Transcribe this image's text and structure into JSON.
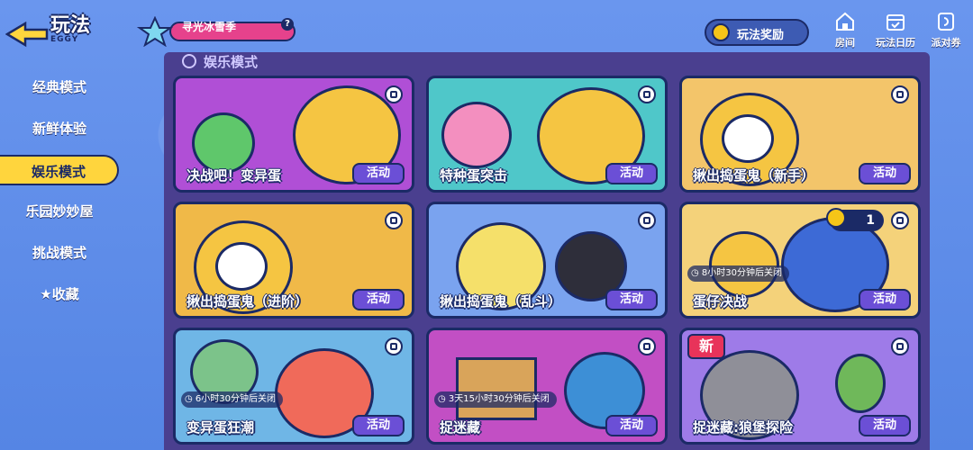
{
  "header": {
    "title": "玩法",
    "subtitle": "EGGY",
    "season_label": "寻光冰雪季",
    "help_icon": "question-icon",
    "reward_label": "玩法奖励",
    "top_icons": [
      {
        "label": "房间",
        "icon": "home-icon"
      },
      {
        "label": "玩法日历",
        "icon": "calendar-icon"
      },
      {
        "label": "派对券",
        "icon": "ticket-icon"
      }
    ]
  },
  "sidebar": {
    "items": [
      {
        "label": "经典模式"
      },
      {
        "label": "新鲜体验"
      },
      {
        "label": "娱乐模式"
      },
      {
        "label": "乐园妙妙屋"
      },
      {
        "label": "挑战模式"
      },
      {
        "label": "★收藏"
      }
    ],
    "active_index": 2
  },
  "panel": {
    "section_title": "娱乐模式",
    "action_label": "活动",
    "cards": [
      {
        "name": "决战吧！变异蛋",
        "theme": "#b04fd6"
      },
      {
        "name": "特种蛋突击",
        "theme": "#4fc7c9"
      },
      {
        "name": "揪出捣蛋鬼（新手）",
        "theme": "#f3c56a"
      },
      {
        "name": "揪出捣蛋鬼（进阶）",
        "theme": "#f0b948"
      },
      {
        "name": "揪出捣蛋鬼（乱斗）",
        "theme": "#7aa3ef"
      },
      {
        "name": "蛋仔决战",
        "theme": "#f4d27a",
        "timer": "8小时30分钟后关闭",
        "trophy_count": "1"
      },
      {
        "name": "变异蛋狂潮",
        "theme": "#6fb6e6",
        "timer": "6小时30分钟后关闭"
      },
      {
        "name": "捉迷藏",
        "theme": "#c24fc4",
        "timer": "3天15小时30分钟后关闭"
      },
      {
        "name": "捉迷藏:狼堡探险",
        "theme": "#9e7be8",
        "badge": "新"
      }
    ]
  },
  "colors": {
    "background": "#5b8be8",
    "panel": "#4a3f8f",
    "accent_yellow": "#ffd53d",
    "outline": "#1b2a66",
    "action_button": "#6b4fd6"
  }
}
